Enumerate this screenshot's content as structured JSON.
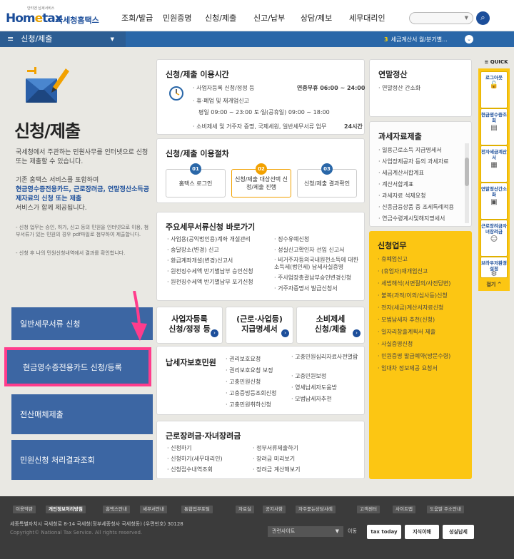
{
  "header": {
    "logo_main": "Hom",
    "logo_e": "e",
    "logo_tax": "tax",
    "logo_kor": "국세청홈택스",
    "logo_tiny": "안티엔 납세서비스",
    "nav": [
      "조회/발급",
      "민원증명",
      "신청/제출",
      "신고/납부",
      "상담/제보",
      "세무대리인"
    ],
    "search_icon": "search-icon"
  },
  "bar": {
    "menu_label": "신청/제출",
    "ticker_num": "3",
    "ticker_text": "세금계산서 월/분기별..."
  },
  "left": {
    "title": "신청/제출",
    "desc1": "국세청에서 주관하는 민원사무를 인터넷으로 신청 또는 제출할 수 있습니다.",
    "desc2_a": "기존 홈택스 서비스를 포함하여",
    "desc2_hl": "현금영수증전용카드, 근로장려금, 연말정산소득공제자료의 신청 또는 제출",
    "desc2_b": "서비스가 함께 제공됩니다.",
    "note1": "- 신청 업무는 승인, 허가, 신고 등의 민원을 인터넷으로 이용, 첨부서류가 있는 민원의 경우 pdf파일로 첨부하여 제출합니다.",
    "note2": "- 신청 후 나의 민원신청내역에서 결과를 확인합니다.",
    "buttons": [
      "일반세무서류 신청",
      "현금영수증전용카드 신청/등록",
      "전산매체제출",
      "민원신청 처리결과조회"
    ]
  },
  "hours": {
    "title": "신청/제출 이용시간",
    "row1_label": "· 사업자등록 신청/정정 등",
    "row1_time": "연중무휴 06:00 ~ 24:00",
    "row2_label": "· 휴·폐업 및 재개업신고",
    "row3_label": "평일 09:00 ~ 23:00 토·일(공휴일) 09:00 ~ 18:00",
    "row4_label": "· 소비제세 및 거주자 증명, 국제세원, 일반세무서류 업무",
    "row4_time": "24시간"
  },
  "procedure": {
    "title": "신청/제출 이용절차",
    "steps": [
      {
        "num": "01",
        "label": "홈택스 로그인"
      },
      {
        "num": "02",
        "label": "신청/제출 대상선택 신청/제출 진행"
      },
      {
        "num": "03",
        "label": "신청/제출 결과확인"
      }
    ]
  },
  "shortcuts": {
    "title": "주요세무서류신청 바로가기",
    "col1": [
      "· 사업용(공익법인용)계좌 개설관리",
      "· 송달장소(변경) 신고",
      "· 환급계좌개설(변경)신고서",
      "· 원천징수세액 반기별납부 승인신청",
      "· 원천징수세액 반기별납부 포기신청"
    ],
    "col2": [
      "· 징수유예신청",
      "· 성실신고확인자 선임 신고서",
      "· 비거주자등의국내원천소득에 대한 소득세(법인세) 납세사실증명",
      "· 주사업장총괄납부승인변경신청",
      "· 거주자증명서 발급신청서"
    ]
  },
  "mid_buttons": [
    {
      "line1": "사업자등록",
      "line2": "신청/정정 등"
    },
    {
      "line1": "(근로·사업등)",
      "line2": "지급명세서"
    },
    {
      "line1": "소비제세",
      "line2": "신청/제출"
    }
  ],
  "taxpayer": {
    "title": "납세자보호민원",
    "col1": [
      "· 권리보호요청",
      "· 권리보호요청 보정",
      "· 고충민원신청",
      "· 고충증빙등조회신청",
      "· 고충민원취하신청"
    ],
    "col2": [
      "· 고충민원심리자료사전열람",
      "· 고충민원보정",
      "· 영세납세자도움방",
      "· 모범납세자추천"
    ]
  },
  "eitc": {
    "title": "근로장려금·자녀장려금",
    "col1": [
      "· 신청하기",
      "· 신청하기(세무대리인)",
      "· 신청접수내역조회"
    ],
    "col2": [
      "· 정부서류제출하기",
      "· 장려금 미리보기",
      "· 장려금 계산해보기"
    ]
  },
  "yearend": {
    "title": "연말정산",
    "items": [
      "· 연말정산 간소화"
    ]
  },
  "taxdata": {
    "title": "과세자료제출",
    "items": [
      "· 일용근로소득 지급명세서",
      "· 사업장제공자 등의 과세자료",
      "· 세금계산서합계표",
      "· 계산서합계표",
      "· 과세자료 석제요청",
      "· 신종금융상품 중 조세특례적용",
      "· 연금수령계시및해지명세서"
    ]
  },
  "apply": {
    "title": "신청업무",
    "items": [
      "· 휴폐업신고",
      "· (휴업자)재개업신고",
      "· 세법해석(서면질의/사전답변)",
      "· 불복(과적/이의/심사등)신청",
      "· 전자(세금)계산서자료신청",
      "· 모범납세자 추천(신청)",
      "· 일자리창출계획서 제출",
      "· 사실증명신청",
      "· 민원증명 발급예약(방문수령)",
      "· 임대차 정보제공 요청서"
    ]
  },
  "quick": {
    "head": "QUICK",
    "items": [
      "로그아웃",
      "현금영수증조회",
      "전자세금계산서",
      "연말정산간소화",
      "근로장려금자녀장려금",
      "브라우저환경설정"
    ],
    "fold": "접기 ^"
  },
  "footer": {
    "links": [
      "이용약관",
      "개인정보처리방침",
      "홈택스안내",
      "세무서안내",
      "통합업무포털",
      "자료실",
      "공지사항",
      "자주묻는상담사례",
      "고객센터",
      "사이트맵",
      "도움말 주소안내"
    ],
    "address": "세종특별자치시 국세청로 8-14 국세청(정부세종청사 국세청동) (우편번호) 30128",
    "copyright": "Copyright© National Tax Service. All rights reserved.",
    "related": "관련사이트",
    "move": "이동",
    "badges": [
      "tax today",
      "지식이해",
      "성실납세"
    ]
  },
  "colors": {
    "accent": "#1c4e9a",
    "bar": "#2a67a8",
    "yellow": "#fcc613",
    "highlight": "#ff3c8c"
  }
}
